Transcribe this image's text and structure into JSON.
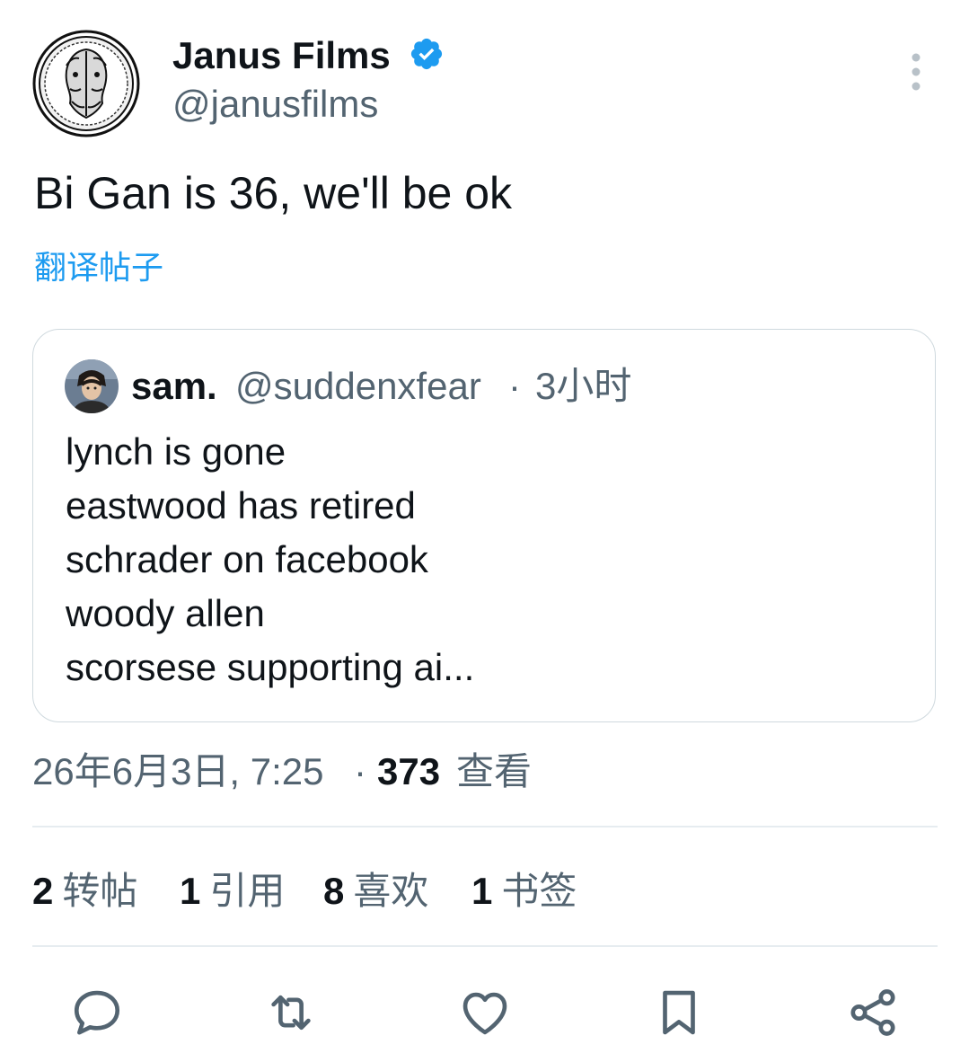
{
  "author": {
    "display_name": "Janus Films",
    "handle": "@janusfilms",
    "verified_icon": "verified-badge-icon",
    "avatar_icon": "janus-coin-avatar"
  },
  "tweet": {
    "text": "Bi Gan is 36, we'll be ok",
    "translate_label": "翻译帖子"
  },
  "quote": {
    "name": "sam.",
    "handle": "@suddenxfear",
    "dot": "·",
    "time": "3小时",
    "lines": [
      "lynch is gone",
      "eastwood has retired",
      "schrader on facebook",
      "woody allen",
      "scorsese supporting ai..."
    ]
  },
  "meta": {
    "date": "26年6月3日, 7:25",
    "dot": "·",
    "views_count": "373",
    "views_label": "查看"
  },
  "stats": [
    {
      "count": "2",
      "label": "转帖"
    },
    {
      "count": "1",
      "label": "引用"
    },
    {
      "count": "8",
      "label": "喜欢"
    },
    {
      "count": "1",
      "label": "书签"
    }
  ],
  "actions": [
    "reply-icon",
    "repost-icon",
    "like-icon",
    "bookmark-icon",
    "share-icon"
  ],
  "colors": {
    "accent": "#1d9bf0",
    "text": "#0f1419",
    "secondary": "#536471",
    "border": "#cfd9de"
  }
}
